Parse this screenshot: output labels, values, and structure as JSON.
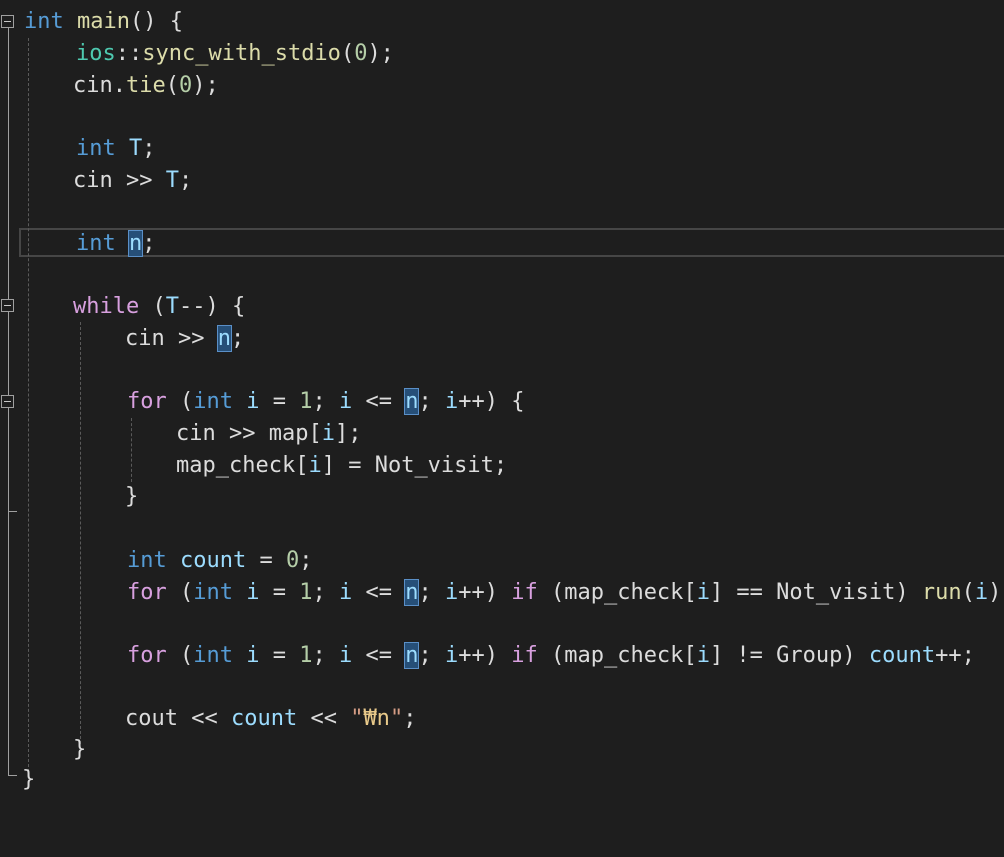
{
  "code": {
    "l1_int": "int",
    "l1_main": "main",
    "l1_rest": "() {",
    "l2_ios": "ios",
    "l2_sep": "::",
    "l2_fn": "sync_with_stdio",
    "l2_open": "(",
    "l2_num": "0",
    "l2_close": ");",
    "l3_cin": "cin",
    "l3_dot": ".",
    "l3_fn": "tie",
    "l3_open": "(",
    "l3_num": "0",
    "l3_close": ");",
    "l5_int": "int",
    "l5_T": "T",
    "l5_semi": ";",
    "l6_cin": "cin",
    "l6_op": " >> ",
    "l6_T": "T",
    "l6_semi": ";",
    "l8_int": "int",
    "l8_n": "n",
    "l8_semi": ";",
    "l10_while": "while",
    "l10_open": " (",
    "l10_T": "T",
    "l10_rest": "--) {",
    "l11_cin": "cin",
    "l11_op": " >> ",
    "l11_n": "n",
    "l11_semi": ";",
    "l13_for": "for",
    "l13_a": " (",
    "l13_int": "int",
    "l13_i1": "i",
    "l13_b": " = ",
    "l13_num": "1",
    "l13_c": "; ",
    "l13_i2": "i",
    "l13_d": " <= ",
    "l13_n": "n",
    "l13_e": "; ",
    "l13_i3": "i",
    "l13_f": "++) {",
    "l14_cin": "cin",
    "l14_op": " >> ",
    "l14_map": "map",
    "l14_a": "[",
    "l14_i": "i",
    "l14_b": "];",
    "l15_mc": "map_check",
    "l15_a": "[",
    "l15_i": "i",
    "l15_b": "] = ",
    "l15_nv": "Not_visit",
    "l15_semi": ";",
    "l16_close": "}",
    "l18_int": "int",
    "l18_count": "count",
    "l18_a": " = ",
    "l18_num": "0",
    "l18_semi": ";",
    "l19_for": "for",
    "l19_a": " (",
    "l19_int": "int",
    "l19_i1": "i",
    "l19_b": " = ",
    "l19_num": "1",
    "l19_c": "; ",
    "l19_i2": "i",
    "l19_d": " <= ",
    "l19_n": "n",
    "l19_e": "; ",
    "l19_i3": "i",
    "l19_f": "++) ",
    "l19_if": "if",
    "l19_g": " (",
    "l19_mc": "map_check",
    "l19_h": "[",
    "l19_i4": "i",
    "l19_j": "] == ",
    "l19_nv": "Not_visit",
    "l19_k": ") ",
    "l19_run": "run",
    "l19_l": "(",
    "l19_i5": "i",
    "l19_m": ");",
    "l21_for": "for",
    "l21_a": " (",
    "l21_int": "int",
    "l21_i1": "i",
    "l21_b": " = ",
    "l21_num": "1",
    "l21_c": "; ",
    "l21_i2": "i",
    "l21_d": " <= ",
    "l21_n": "n",
    "l21_e": "; ",
    "l21_i3": "i",
    "l21_f": "++) ",
    "l21_if": "if",
    "l21_g": " (",
    "l21_mc": "map_check",
    "l21_h": "[",
    "l21_i4": "i",
    "l21_j": "] != ",
    "l21_grp": "Group",
    "l21_k": ") ",
    "l21_count": "count",
    "l21_l": "++;",
    "l23_cout": "cout",
    "l23_a": " << ",
    "l23_count": "count",
    "l23_b": " << ",
    "l23_q1": "\"",
    "l23_esc": "₩n",
    "l23_q2": "\"",
    "l23_semi": ";",
    "l24_close": "}",
    "l25_close": "}"
  },
  "colors": {
    "background": "#1e1e1e",
    "keyword": "#569cd6",
    "control": "#d8a0df",
    "type": "#4ec9b0",
    "function": "#dcdcaa",
    "variable": "#9cdcfe",
    "number": "#b5cea8",
    "string": "#d69d85",
    "reference_highlight": "#264f78"
  },
  "icons": [
    "collapse-icon"
  ]
}
